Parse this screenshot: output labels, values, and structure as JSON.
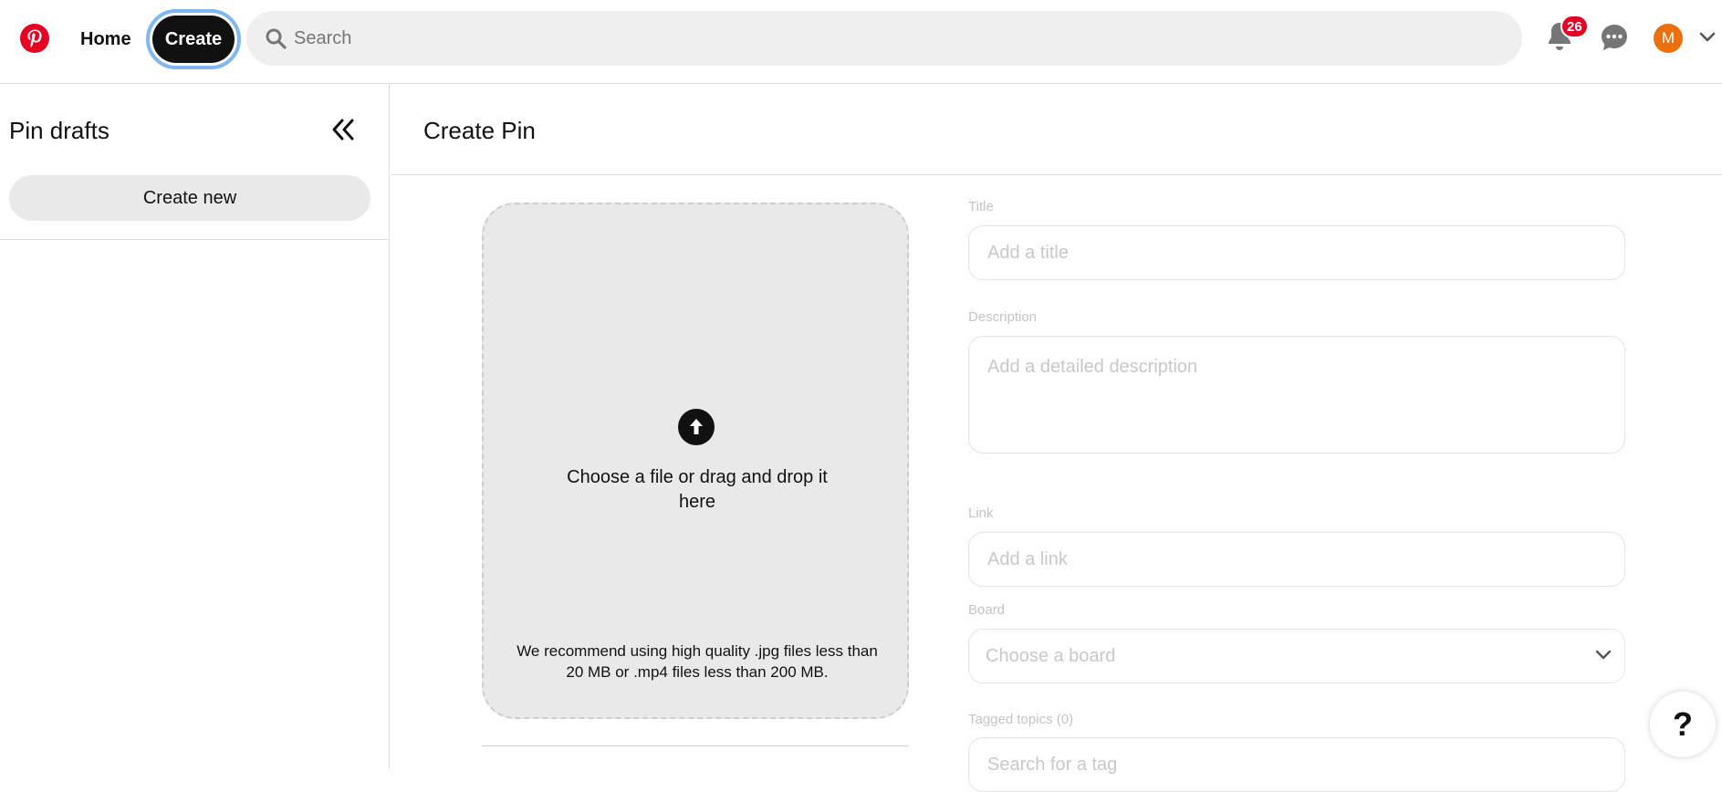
{
  "header": {
    "home_label": "Home",
    "create_label": "Create",
    "search_placeholder": "Search",
    "notification_count": "26",
    "avatar_initial": "M"
  },
  "sidebar": {
    "title": "Pin drafts",
    "create_new_label": "Create new"
  },
  "main": {
    "title": "Create Pin",
    "upload": {
      "prompt": "Choose a file or drag and drop it here",
      "recommendation": "We recommend using high quality .jpg files less than 20 MB or .mp4 files less than 200 MB."
    },
    "fields": {
      "title_label": "Title",
      "title_placeholder": "Add a title",
      "description_label": "Description",
      "description_placeholder": "Add a detailed description",
      "link_label": "Link",
      "link_placeholder": "Add a link",
      "board_label": "Board",
      "board_placeholder": "Choose a board",
      "tags_label": "Tagged topics (0)",
      "tags_placeholder": "Search for a tag"
    }
  },
  "help_label": "?",
  "colors": {
    "brand": "#e60023",
    "avatar": "#e9700b",
    "create_focus_ring": "#7fb8f0"
  },
  "icons": [
    "pinterest-logo-icon",
    "search-icon",
    "bell-icon",
    "messages-icon",
    "chevron-down-icon",
    "collapse-left-icon",
    "upload-arrow-icon",
    "help-icon"
  ]
}
